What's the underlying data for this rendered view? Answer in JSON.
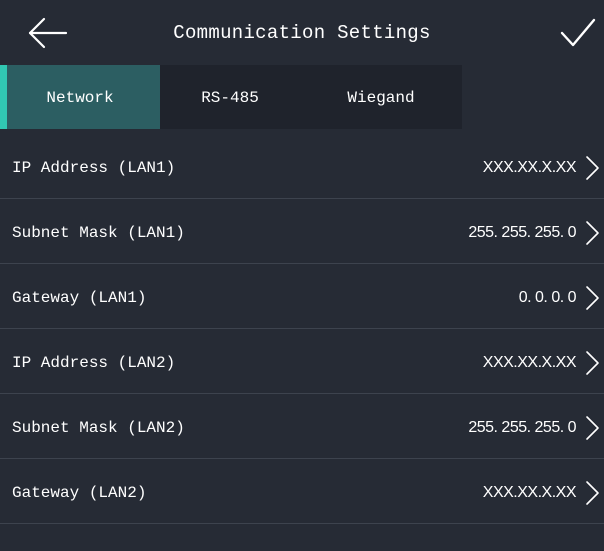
{
  "header": {
    "title": "Communication Settings"
  },
  "tabs": [
    {
      "label": "Network",
      "active": true
    },
    {
      "label": "RS-485",
      "active": false
    },
    {
      "label": "Wiegand",
      "active": false
    }
  ],
  "rows": [
    {
      "label": "IP Address (LAN1)",
      "value": "XXX.XX.X.XX"
    },
    {
      "label": "Subnet Mask (LAN1)",
      "value": "255. 255. 255. 0"
    },
    {
      "label": "Gateway (LAN1)",
      "value": "0. 0. 0. 0"
    },
    {
      "label": "IP Address (LAN2)",
      "value": "XXX.XX.X.XX"
    },
    {
      "label": "Subnet Mask (LAN2)",
      "value": "255. 255. 255. 0"
    },
    {
      "label": "Gateway (LAN2)",
      "value": "XXX.XX.X.XX"
    }
  ],
  "colors": {
    "background": "#262b35",
    "tab_background": "#1f232c",
    "active_tab": "#2c5e62",
    "accent": "#31c8b3",
    "divider": "#3d434e"
  },
  "icons": {
    "back": "arrow-left-icon",
    "confirm": "checkmark-icon",
    "row": "chevron-right-icon"
  }
}
